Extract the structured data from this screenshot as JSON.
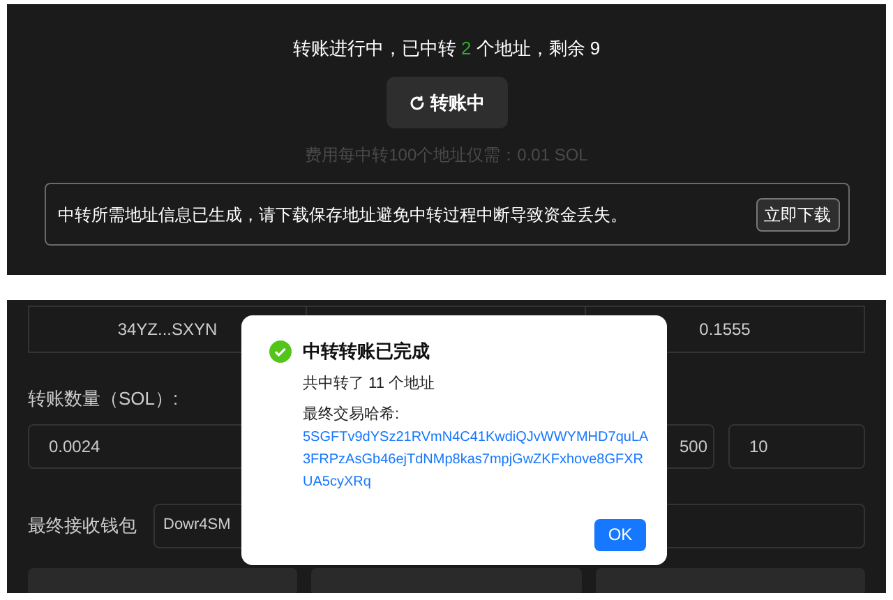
{
  "progress": {
    "status_prefix": "转账进行中，已中转",
    "relayed_count": "2",
    "status_suffix": "个地址，剩余 9",
    "button": {
      "label": "转账中"
    },
    "fee_note": "费用每中转100个地址仅需：0.01 SOL",
    "alert": {
      "text": "中转所需地址信息已生成，请下载保存地址避免中转过程中断导致资金丢失。",
      "button": "立即下载"
    }
  },
  "form": {
    "table_row": [
      "34YZ...SXYN",
      "0.1555"
    ],
    "amount_label": "转账数量（SOL）:",
    "amount_fields": [
      {
        "value": "0.0024"
      },
      {
        "value": "500"
      },
      {
        "value": "10"
      }
    ],
    "wallet_label": "最终接收钱包",
    "wallet_value": "Dowr4SM"
  },
  "dialog": {
    "title": "中转转账已完成",
    "summary": "共中转了 11 个地址",
    "hash_label": "最终交易哈希:",
    "hash": "5SGFTv9dYSz21RVmN4C41KwdiQJvWWYMHD7quLA3FRPzAsGb46ejTdNMp8kas7mpjGwZKFxhove8GFXRUA5cyXRq",
    "ok": "OK"
  }
}
